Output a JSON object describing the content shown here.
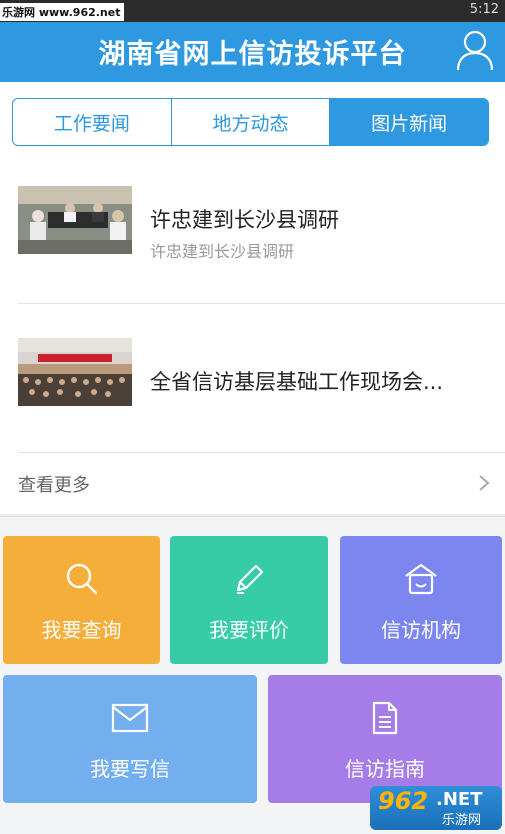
{
  "status_bar": {
    "watermark": "乐游网 www.962.net",
    "time": "5:12"
  },
  "header": {
    "title": "湖南省网上信访投诉平台",
    "user_icon": "user-icon",
    "color": "#2e99e0"
  },
  "tabs": [
    {
      "label": "工作要闻",
      "active": false
    },
    {
      "label": "地方动态",
      "active": false
    },
    {
      "label": "图片新闻",
      "active": true
    }
  ],
  "news": [
    {
      "title": "许忠建到长沙县调研",
      "subtitle": "许忠建到长沙县调研"
    },
    {
      "title": "全省信访基层基础工作现场会...",
      "subtitle": ""
    }
  ],
  "more": {
    "label": "查看更多",
    "icon": "chevron-right-icon"
  },
  "tiles": [
    {
      "label": "我要查询",
      "icon": "search-icon",
      "color": "#f6ae3a"
    },
    {
      "label": "我要评价",
      "icon": "pen-icon",
      "color": "#35cca6"
    },
    {
      "label": "信访机构",
      "icon": "house-icon",
      "color": "#7b86ee"
    },
    {
      "label": "我要写信",
      "icon": "mail-icon",
      "color": "#73aeee"
    },
    {
      "label": "信访指南",
      "icon": "document-icon",
      "color": "#a67de8"
    }
  ],
  "watermark_bottom": {
    "number": "962",
    "net": ".NET",
    "cn": "乐游网"
  }
}
